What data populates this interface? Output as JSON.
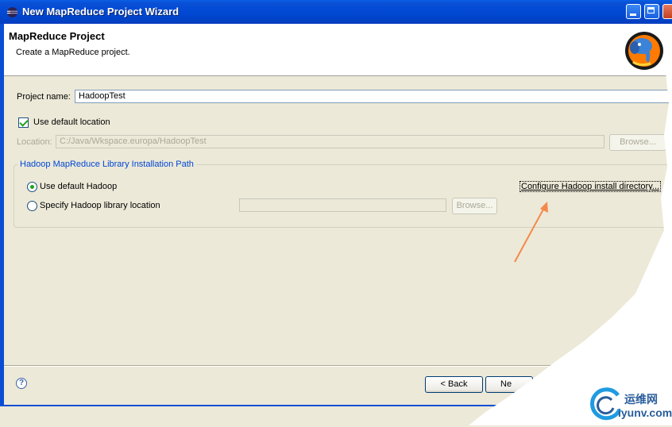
{
  "window": {
    "title": "New MapReduce Project Wizard"
  },
  "header": {
    "title": "MapReduce Project",
    "description": "Create a MapReduce project."
  },
  "form": {
    "project_name_label": "Project name:",
    "project_name_value": "HadoopTest",
    "use_default_location_label": "Use default location",
    "use_default_location_checked": true,
    "location_label": "Location:",
    "location_value": "C:/Java/Wkspace.europa/HadoopTest",
    "location_browse_label": "Browse..."
  },
  "hadoop_group": {
    "title": "Hadoop MapReduce Library Installation Path",
    "use_default_label": "Use default Hadoop",
    "use_default_selected": true,
    "specify_label": "Specify Hadoop library location",
    "specify_value": "",
    "browse_label": "Browse...",
    "configure_link": "Configure Hadoop install directory..."
  },
  "footer": {
    "back_label": "< Back",
    "next_label": "Ne"
  },
  "watermark": {
    "cn": "运维网",
    "en": "iyunv.com"
  },
  "colors": {
    "titlebar": "#0149d4",
    "group_title": "#0046d5",
    "arrow": "#f4894a"
  }
}
